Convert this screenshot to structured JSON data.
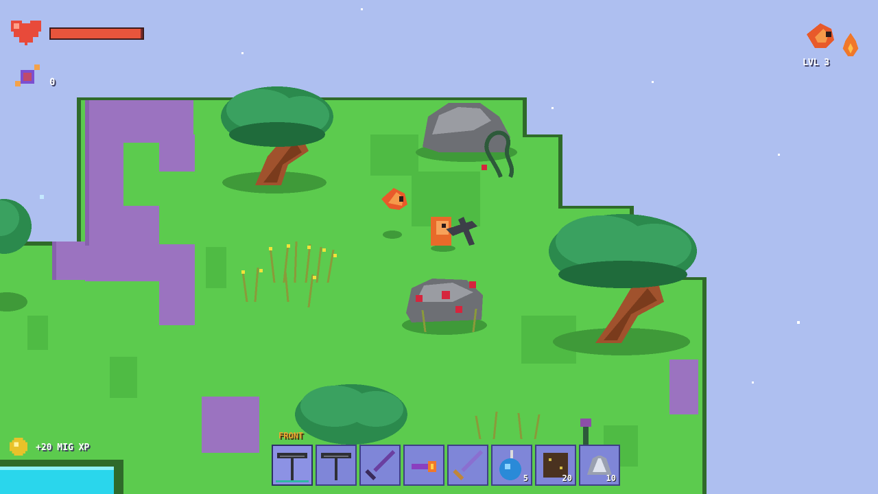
{
  "hud": {
    "health_fraction": 0.98,
    "gem_count": "0",
    "level_label": "LVL 3",
    "xp_popup": "+20 MIG XP"
  },
  "hotbar": {
    "front_label": "FRONT",
    "slots": [
      {
        "icon": "pickaxe-icon",
        "count": ""
      },
      {
        "icon": "pickaxe-icon",
        "count": ""
      },
      {
        "icon": "purple-sword-icon",
        "count": ""
      },
      {
        "icon": "magic-wand-icon",
        "count": ""
      },
      {
        "icon": "steel-sword-icon",
        "count": ""
      },
      {
        "icon": "blue-bomb-icon",
        "count": "5"
      },
      {
        "icon": "dirt-block-icon",
        "count": "20"
      },
      {
        "icon": "iron-ore-icon",
        "count": "10"
      }
    ]
  },
  "colors": {
    "sky": "#aebff0",
    "grass": "#5ccb4e",
    "dark_grass": "#4cb341",
    "purple_ground": "#9b73c0",
    "water": "#2ad6ec",
    "health": "#e8553c"
  }
}
